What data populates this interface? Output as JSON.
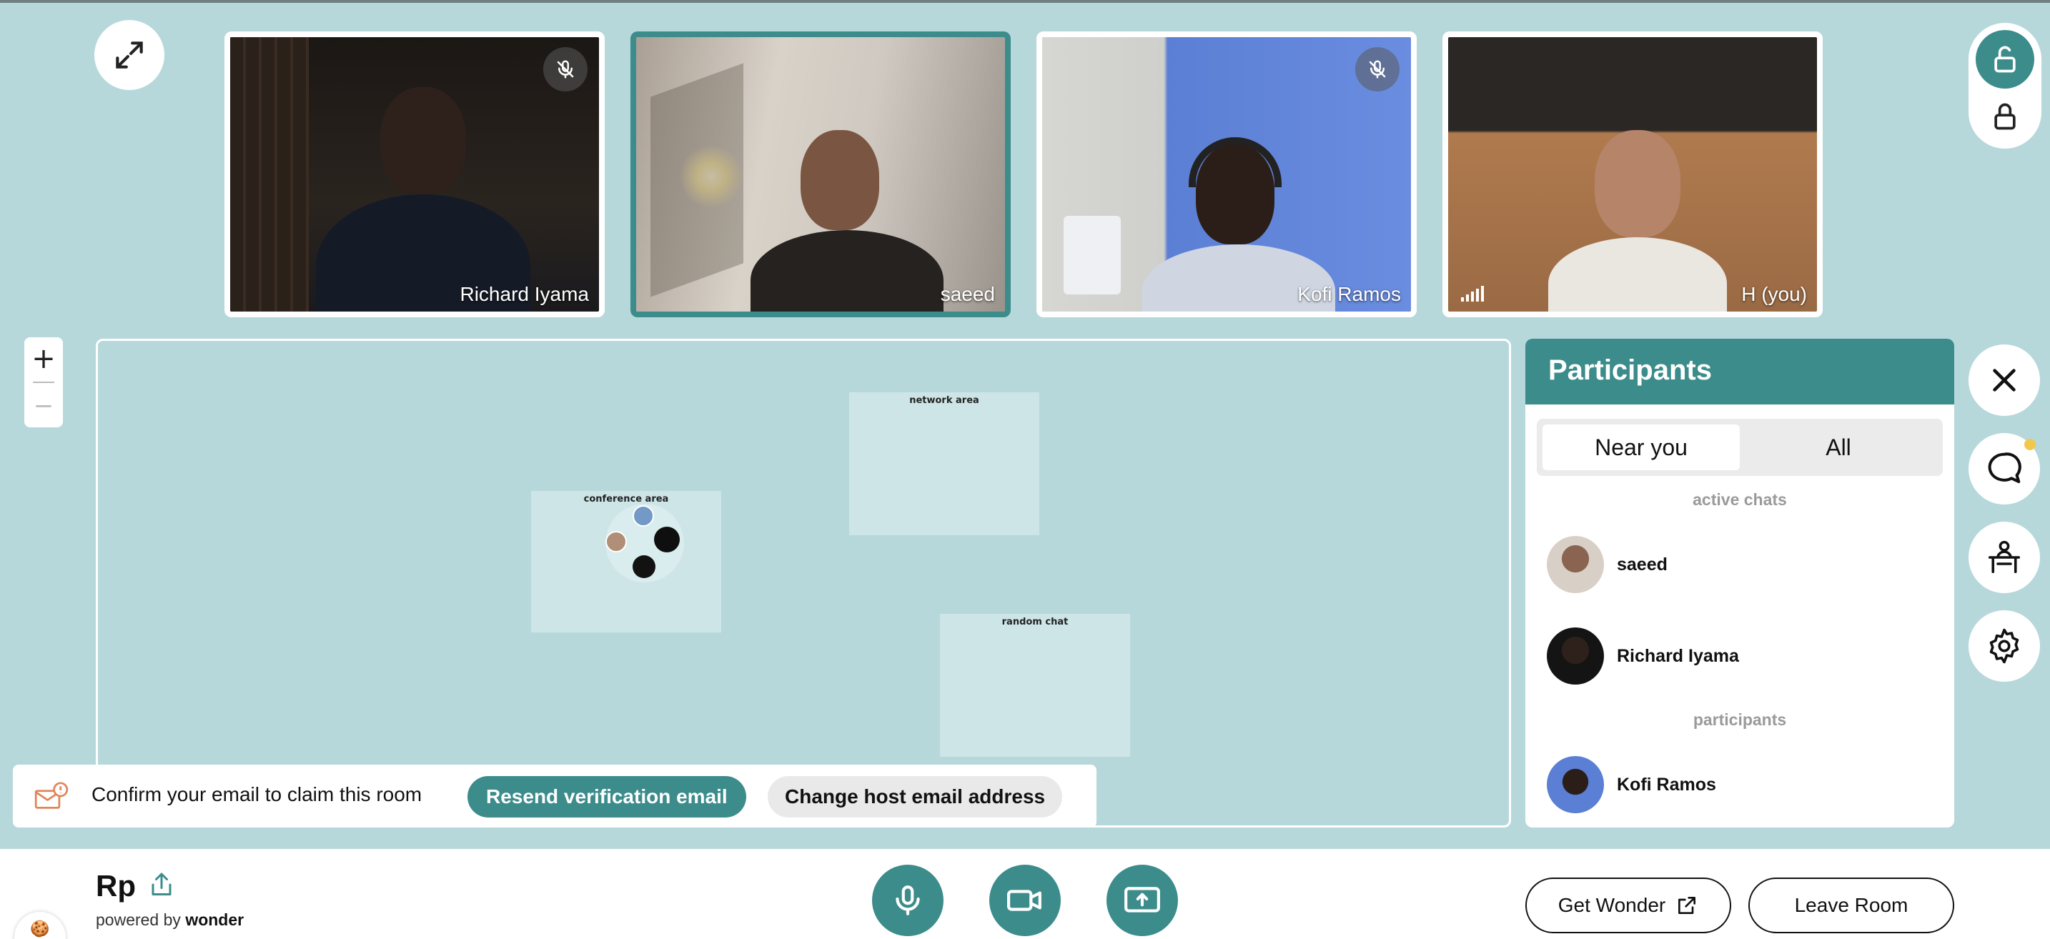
{
  "videos": [
    {
      "name": "Richard Iyama",
      "muted": true,
      "active": false
    },
    {
      "name": "saeed",
      "muted": false,
      "active": true
    },
    {
      "name": "Kofi Ramos",
      "muted": true,
      "active": false
    },
    {
      "name": "H (you)",
      "muted": false,
      "active": false
    }
  ],
  "zoom": {
    "in_label": "+",
    "out_label": "−"
  },
  "map": {
    "areas": [
      {
        "label": "network area"
      },
      {
        "label": "conference area"
      },
      {
        "label": "random chat"
      }
    ]
  },
  "banner": {
    "text": "Confirm your email to claim this room",
    "resend_label": "Resend verification email",
    "change_label": "Change host email address"
  },
  "participants_panel": {
    "title": "Participants",
    "tabs": [
      {
        "label": "Near you",
        "selected": true
      },
      {
        "label": "All",
        "selected": false
      }
    ],
    "sections": [
      {
        "label": "active chats",
        "people": [
          "saeed",
          "Richard Iyama"
        ]
      },
      {
        "label": "participants",
        "people": [
          "Kofi Ramos"
        ]
      }
    ]
  },
  "room": {
    "name": "Rp",
    "powered_by": "powered by",
    "brand": "wonder"
  },
  "bottom_buttons": {
    "get_wonder_label": "Get Wonder",
    "leave_label": "Leave Room"
  },
  "colors": {
    "accent": "#3d8c8c",
    "background": "#b7d8db",
    "notification": "#f1c84b"
  },
  "icons": [
    "expand-icon",
    "mic-off-icon",
    "signal-icon",
    "unlock-icon",
    "lock-icon",
    "close-icon",
    "chat-icon",
    "desk-icon",
    "gear-icon",
    "mail-alert-icon",
    "share-icon",
    "cookie-icon",
    "mic-icon",
    "camera-icon",
    "screen-share-icon",
    "external-link-icon"
  ]
}
